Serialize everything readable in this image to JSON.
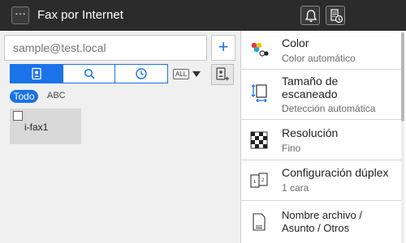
{
  "topbar": {
    "menu_label": "···",
    "title": "Fax por Internet"
  },
  "address": {
    "placeholder": "sample@test.local",
    "add_label": "+"
  },
  "filters": {
    "all_chip": "ALL",
    "todo": "Todo",
    "abc": "ABC"
  },
  "destinations": [
    {
      "name": "i-fax1"
    }
  ],
  "settings": [
    {
      "name": "Color",
      "value": "Color automático"
    },
    {
      "name": "Tamaño de escaneado",
      "value": "Detección automática"
    },
    {
      "name": "Resolución",
      "value": "Fino"
    },
    {
      "name": "Configuración dúplex",
      "value": "1 cara"
    },
    {
      "name": "Nombre archivo / Asunto / Otros",
      "value": ""
    }
  ],
  "colors": {
    "topbar": "#2b2b2b",
    "accent": "#1a73e8",
    "panel": "#f0f0f0"
  }
}
